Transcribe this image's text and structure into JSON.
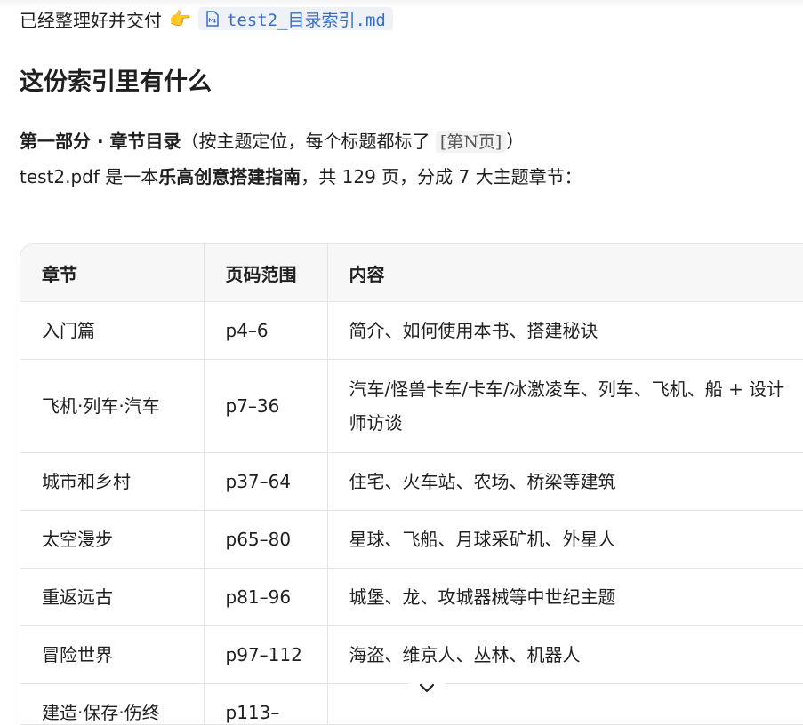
{
  "intro": {
    "text": "已经整理好并交付",
    "pointer_emoji": "👉",
    "file_chip": "test2_目录索引.md"
  },
  "heading": "这份索引里有什么",
  "part_line": {
    "bold": "第一部分 · 章节目录",
    "text_before_code": "（按主题定位，每个标题都标了",
    "code": "[第N页]",
    "text_after_code": "）"
  },
  "summary_line": {
    "prefix": "test2.pdf 是一本",
    "bold": "乐高创意搭建指南",
    "suffix": "，共 129 页，分成 7 大主题章节："
  },
  "table": {
    "headers": [
      "章节",
      "页码范围",
      "内容"
    ],
    "rows": [
      {
        "chapter": "入门篇",
        "pages": "p4–6",
        "content": "简介、如何使用本书、搭建秘诀"
      },
      {
        "chapter": "飞机·列车·汽车",
        "pages": "p7–36",
        "content": "汽车/怪兽卡车/卡车/冰激凌车、列车、飞机、船 + 设计师访谈"
      },
      {
        "chapter": "城市和乡村",
        "pages": "p37–64",
        "content": "住宅、火车站、农场、桥梁等建筑"
      },
      {
        "chapter": "太空漫步",
        "pages": "p65–80",
        "content": "星球、飞船、月球采矿机、外星人"
      },
      {
        "chapter": "重返远古",
        "pages": "p81–96",
        "content": "城堡、龙、攻城器械等中世纪主题"
      },
      {
        "chapter": "冒险世界",
        "pages": "p97–112",
        "content": "海盗、维京人、丛林、机器人"
      },
      {
        "chapter": "建造·保存·伤终",
        "pages": "p113–",
        "content": ""
      }
    ]
  },
  "icons": {
    "file": "markdown-file-icon",
    "scroll": "chevron-down-icon"
  },
  "colors": {
    "link": "#3a6fbf",
    "chip_bg": "#eef2f7",
    "border": "#e4e4e4",
    "header_bg": "#f7f7f7"
  }
}
